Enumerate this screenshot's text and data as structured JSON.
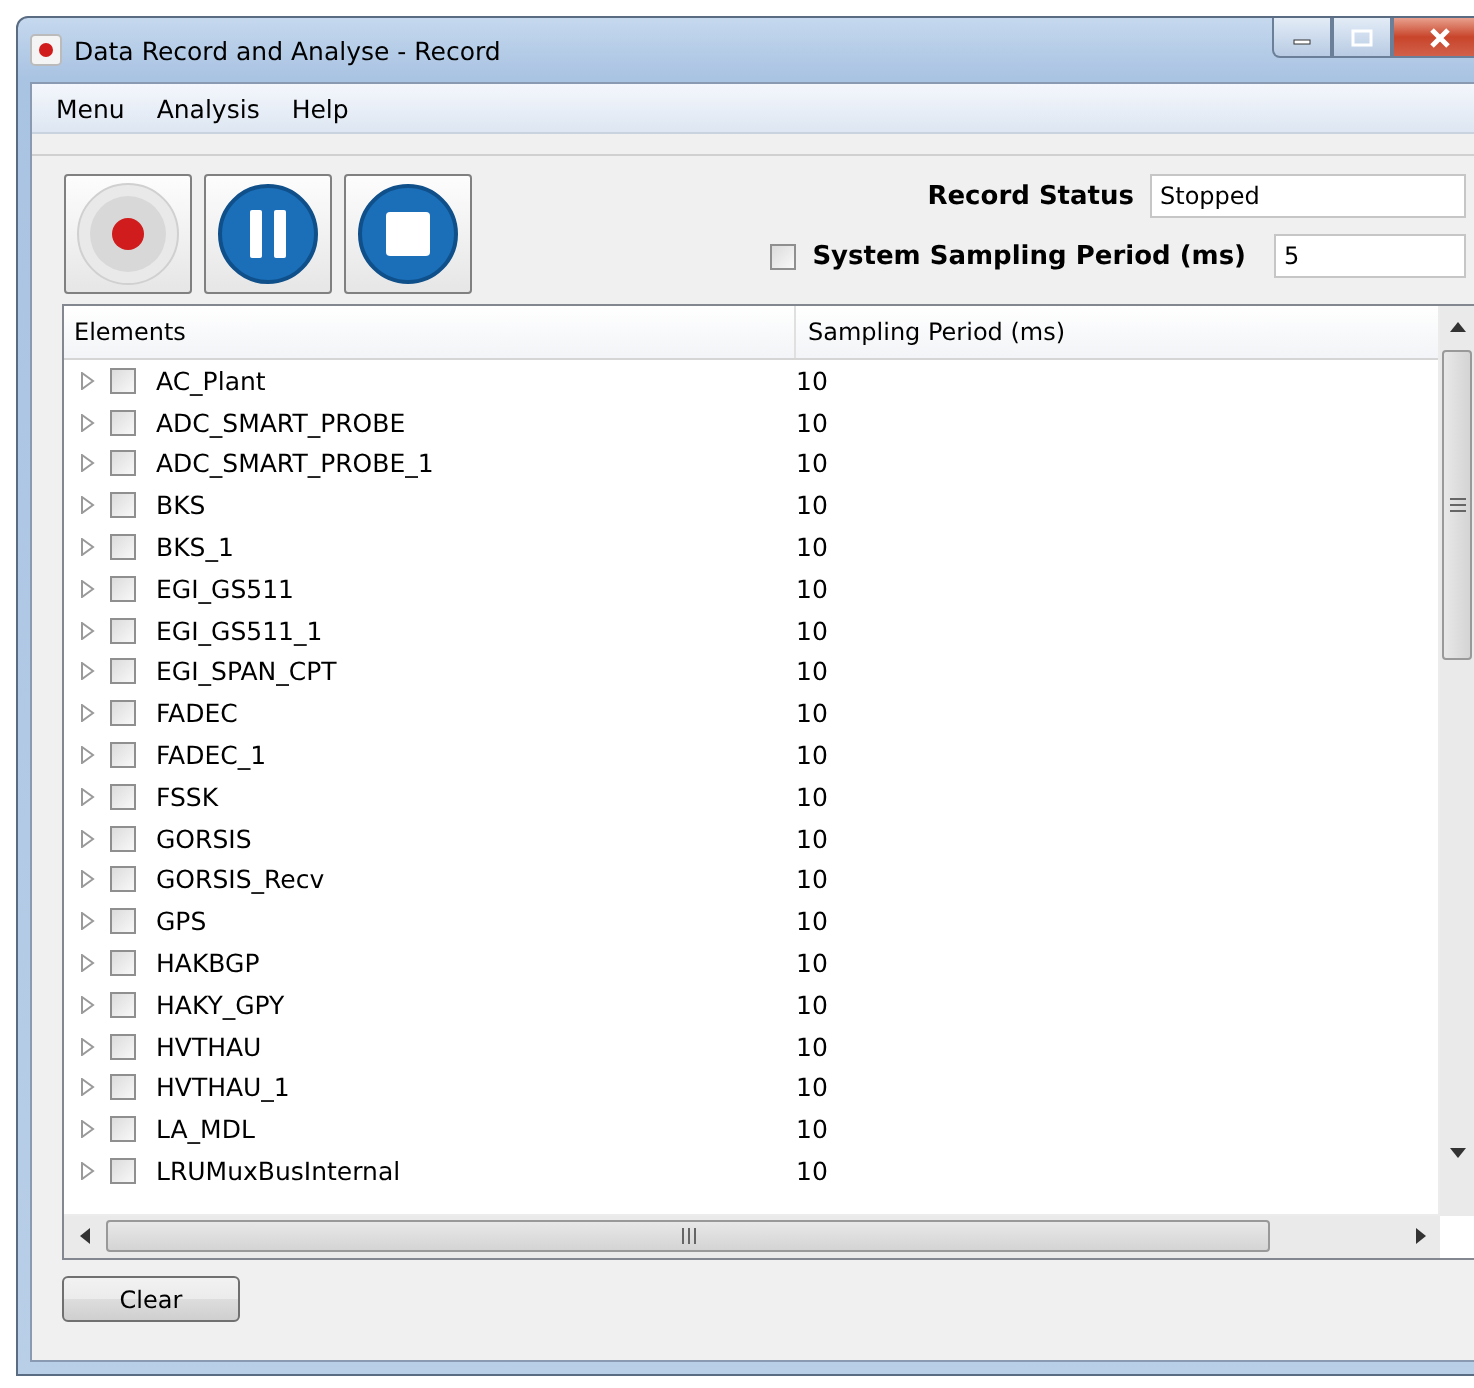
{
  "window": {
    "title": "Data Record and Analyse - Record"
  },
  "menu": [
    "Menu",
    "Analysis",
    "Help"
  ],
  "record_status": {
    "label": "Record Status",
    "value": "Stopped"
  },
  "system_sampling": {
    "label": "System Sampling Period (ms)",
    "checked": false,
    "value": "5"
  },
  "table": {
    "columns": [
      "Elements",
      "Sampling Period (ms)"
    ],
    "rows": [
      {
        "name": "AC_Plant",
        "checked": false,
        "period": "10"
      },
      {
        "name": "ADC_SMART_PROBE",
        "checked": false,
        "period": "10"
      },
      {
        "name": "ADC_SMART_PROBE_1",
        "checked": false,
        "period": "10"
      },
      {
        "name": "BKS",
        "checked": false,
        "period": "10"
      },
      {
        "name": "BKS_1",
        "checked": false,
        "period": "10"
      },
      {
        "name": "EGI_GS511",
        "checked": false,
        "period": "10"
      },
      {
        "name": "EGI_GS511_1",
        "checked": false,
        "period": "10"
      },
      {
        "name": "EGI_SPAN_CPT",
        "checked": false,
        "period": "10"
      },
      {
        "name": "FADEC",
        "checked": false,
        "period": "10"
      },
      {
        "name": "FADEC_1",
        "checked": false,
        "period": "10"
      },
      {
        "name": "FSSK",
        "checked": false,
        "period": "10"
      },
      {
        "name": "GORSIS",
        "checked": false,
        "period": "10"
      },
      {
        "name": "GORSIS_Recv",
        "checked": false,
        "period": "10"
      },
      {
        "name": "GPS",
        "checked": false,
        "period": "10"
      },
      {
        "name": "HAKBGP",
        "checked": false,
        "period": "10"
      },
      {
        "name": "HAKY_GPY",
        "checked": false,
        "period": "10"
      },
      {
        "name": "HVTHAU",
        "checked": false,
        "period": "10"
      },
      {
        "name": "HVTHAU_1",
        "checked": false,
        "period": "10"
      },
      {
        "name": "LA_MDL",
        "checked": false,
        "period": "10"
      },
      {
        "name": "LRUMuxBusInternal",
        "checked": false,
        "period": "10"
      }
    ]
  },
  "buttons": [
    "Clear"
  ]
}
